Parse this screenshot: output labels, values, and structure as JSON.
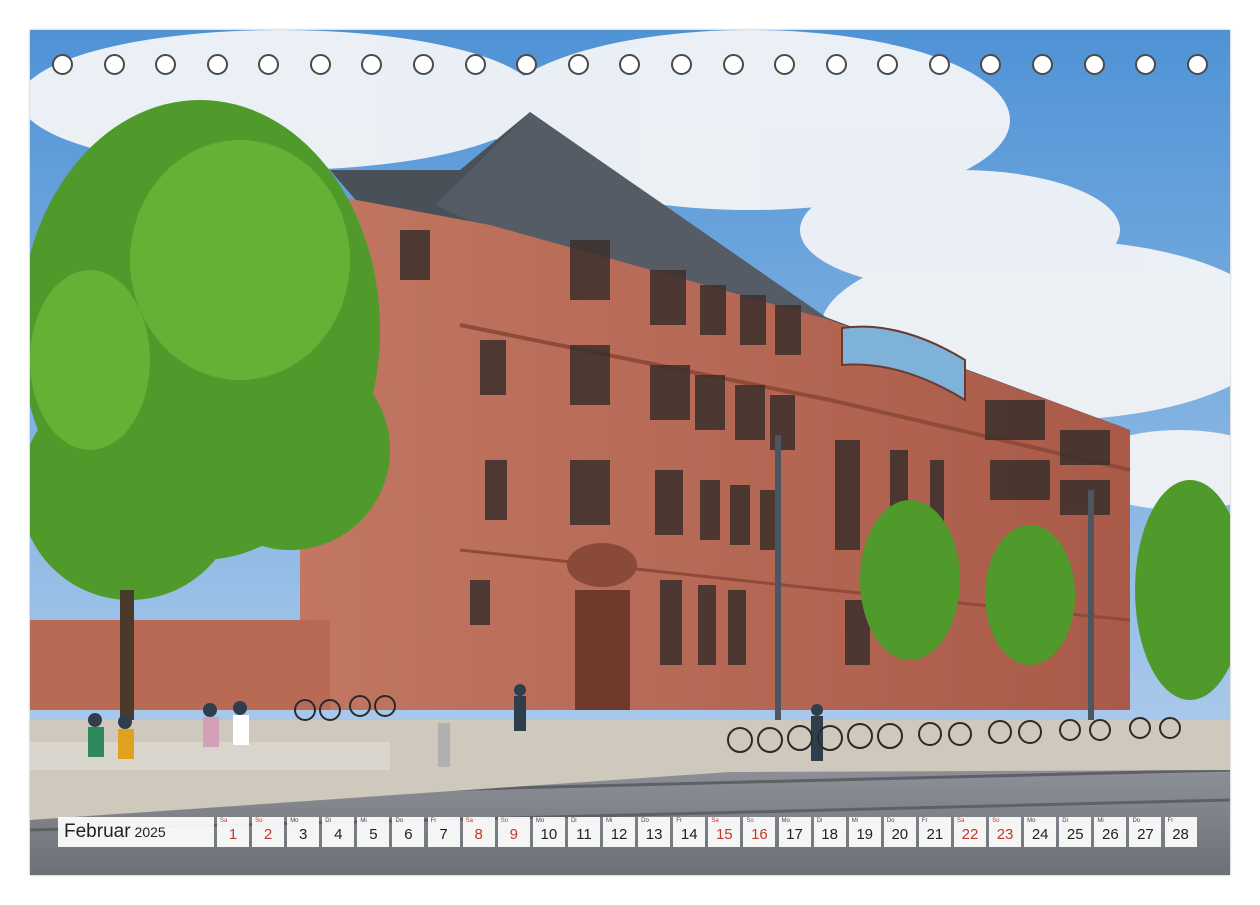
{
  "calendar": {
    "month": "Februar",
    "year": "2025",
    "days": [
      {
        "dow": "Sa",
        "num": "1",
        "weekend": true
      },
      {
        "dow": "So",
        "num": "2",
        "weekend": true
      },
      {
        "dow": "Mo",
        "num": "3",
        "weekend": false
      },
      {
        "dow": "Di",
        "num": "4",
        "weekend": false
      },
      {
        "dow": "Mi",
        "num": "5",
        "weekend": false
      },
      {
        "dow": "Do",
        "num": "6",
        "weekend": false
      },
      {
        "dow": "Fr",
        "num": "7",
        "weekend": false
      },
      {
        "dow": "Sa",
        "num": "8",
        "weekend": true
      },
      {
        "dow": "So",
        "num": "9",
        "weekend": true
      },
      {
        "dow": "Mo",
        "num": "10",
        "weekend": false
      },
      {
        "dow": "Di",
        "num": "11",
        "weekend": false
      },
      {
        "dow": "Mi",
        "num": "12",
        "weekend": false
      },
      {
        "dow": "Do",
        "num": "13",
        "weekend": false
      },
      {
        "dow": "Fr",
        "num": "14",
        "weekend": false
      },
      {
        "dow": "Sa",
        "num": "15",
        "weekend": true
      },
      {
        "dow": "So",
        "num": "16",
        "weekend": true
      },
      {
        "dow": "Mo",
        "num": "17",
        "weekend": false
      },
      {
        "dow": "Di",
        "num": "18",
        "weekend": false
      },
      {
        "dow": "Mi",
        "num": "19",
        "weekend": false
      },
      {
        "dow": "Do",
        "num": "20",
        "weekend": false
      },
      {
        "dow": "Fr",
        "num": "21",
        "weekend": false
      },
      {
        "dow": "Sa",
        "num": "22",
        "weekend": true
      },
      {
        "dow": "So",
        "num": "23",
        "weekend": true
      },
      {
        "dow": "Mo",
        "num": "24",
        "weekend": false
      },
      {
        "dow": "Di",
        "num": "25",
        "weekend": false
      },
      {
        "dow": "Mi",
        "num": "26",
        "weekend": false
      },
      {
        "dow": "Do",
        "num": "27",
        "weekend": false
      },
      {
        "dow": "Fr",
        "num": "28",
        "weekend": false
      }
    ]
  },
  "binding_hole_count": 23,
  "colors": {
    "weekend": "#c0392b",
    "sky": "#3f8fd8",
    "sandstone": "#b96a55",
    "roof": "#4a5058",
    "foliage": "#4f9a2a"
  }
}
